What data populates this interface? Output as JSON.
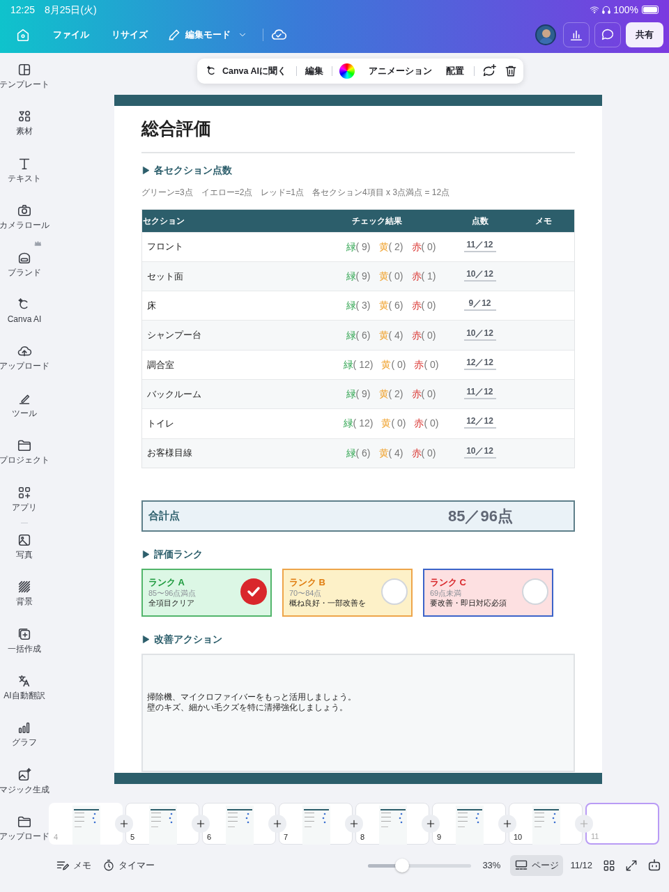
{
  "status_bar": {
    "time": "12:25",
    "date": "8月25日(火)",
    "battery": "100%"
  },
  "header": {
    "menu": [
      {
        "label": "ファイル",
        "kind": "plain"
      },
      {
        "label": "リサイズ",
        "kind": "plain"
      },
      {
        "label": "編集モード",
        "kind": "mode"
      }
    ],
    "share": "共有"
  },
  "toolbar": {
    "items": [
      "Canva AIに聞く",
      "編集",
      "アニメーション",
      "配置"
    ]
  },
  "sidebar": {
    "items": [
      {
        "label": "テンプレート"
      },
      {
        "label": "素材"
      },
      {
        "label": "テキスト"
      },
      {
        "label": "カメラロール"
      },
      {
        "label": "ブランド"
      },
      {
        "label": "Canva AI"
      },
      {
        "label": "アップロード"
      },
      {
        "label": "ツール"
      },
      {
        "label": "プロジェクト"
      },
      {
        "label": "アプリ"
      },
      {
        "label": "写真"
      },
      {
        "label": "背景"
      },
      {
        "label": "一括作成"
      },
      {
        "label": "AI自動翻訳"
      },
      {
        "label": "グラフ"
      },
      {
        "label": "マジック生成"
      },
      {
        "label": "アップロード"
      }
    ]
  },
  "document": {
    "title": "総合評価",
    "scores": {
      "heading": "各セクション点数",
      "legend": "グリーン=3点　イエロー=2点　レッド=1点　各セクション4項目 x 3点満点 = 12点",
      "columns": [
        "セクション",
        "チェック結果",
        "点数",
        "メモ"
      ],
      "rows": [
        {
          "section": "フロント",
          "checks": [
            {
              "kind": "green",
              "label": "緑",
              "count": "( 9)"
            },
            {
              "kind": "yellow",
              "label": "黄",
              "count": "( 2)"
            },
            {
              "kind": "red",
              "label": "赤",
              "count": "( 0)"
            }
          ],
          "score": "11／12"
        },
        {
          "section": "セット面",
          "checks": [
            {
              "kind": "green",
              "label": "緑",
              "count": "( 9)"
            },
            {
              "kind": "yellow",
              "label": "黄",
              "count": "( 0)"
            },
            {
              "kind": "red",
              "label": "赤",
              "count": "( 1)"
            }
          ],
          "score": "10／12"
        },
        {
          "section": "床",
          "checks": [
            {
              "kind": "green",
              "label": "緑",
              "count": "( 3)"
            },
            {
              "kind": "yellow",
              "label": "黄",
              "count": "( 6)"
            },
            {
              "kind": "red",
              "label": "赤",
              "count": "( 0)"
            }
          ],
          "score": "9／12"
        },
        {
          "section": "シャンプー台",
          "checks": [
            {
              "kind": "green",
              "label": "緑",
              "count": "( 6)"
            },
            {
              "kind": "yellow",
              "label": "黄",
              "count": "( 4)"
            },
            {
              "kind": "red",
              "label": "赤",
              "count": "( 0)"
            }
          ],
          "score": "10／12"
        },
        {
          "section": "調合室",
          "checks": [
            {
              "kind": "green",
              "label": "緑",
              "count": "( 12)"
            },
            {
              "kind": "yellow",
              "label": "黄",
              "count": "( 0)"
            },
            {
              "kind": "red",
              "label": "赤",
              "count": "( 0)"
            }
          ],
          "score": "12／12"
        },
        {
          "section": "バックルーム",
          "checks": [
            {
              "kind": "green",
              "label": "緑",
              "count": "( 9)"
            },
            {
              "kind": "yellow",
              "label": "黄",
              "count": "( 2)"
            },
            {
              "kind": "red",
              "label": "赤",
              "count": "( 0)"
            }
          ],
          "score": "11／12"
        },
        {
          "section": "トイレ",
          "checks": [
            {
              "kind": "green",
              "label": "緑",
              "count": "( 12)"
            },
            {
              "kind": "yellow",
              "label": "黄",
              "count": "( 0)"
            },
            {
              "kind": "red",
              "label": "赤",
              "count": "( 0)"
            }
          ],
          "score": "12／12"
        },
        {
          "section": "お客様目線",
          "checks": [
            {
              "kind": "green",
              "label": "緑",
              "count": "( 6)"
            },
            {
              "kind": "yellow",
              "label": "黄",
              "count": "( 4)"
            },
            {
              "kind": "red",
              "label": "赤",
              "count": "( 0)"
            }
          ],
          "score": "10／12"
        }
      ]
    },
    "total": {
      "label": "合計点",
      "value": "85／96点"
    },
    "ranks": {
      "heading": "評価ランク",
      "items": [
        {
          "kind": "a",
          "title": "ランク A",
          "range": "85〜96点満点",
          "note": "全項目クリア",
          "selected": true
        },
        {
          "kind": "b",
          "title": "ランク B",
          "range": "70〜84点",
          "note": "概ね良好・一部改善を",
          "selected": false
        },
        {
          "kind": "c",
          "title": "ランク C",
          "range": "69点未満",
          "note": "要改善・即日対応必須",
          "selected": false
        }
      ]
    },
    "actions": {
      "heading": "改善アクション",
      "lines": [
        "掃除機、マイクロファイバーをもっと活用しましょう。",
        "壁のキズ、細かい毛クズを特に清掃強化しましょう。"
      ]
    }
  },
  "pages": [
    {
      "number": "4",
      "selected": false
    },
    {
      "number": "5",
      "selected": false
    },
    {
      "number": "6",
      "selected": false
    },
    {
      "number": "7",
      "selected": false
    },
    {
      "number": "8",
      "selected": false
    },
    {
      "number": "9",
      "selected": false
    },
    {
      "number": "10",
      "selected": false
    },
    {
      "number": "11",
      "selected": true
    }
  ],
  "footer": {
    "memo": "メモ",
    "timer": "タイマー",
    "zoom": {
      "level": 0.33,
      "reading": "33%"
    },
    "page_view": "ページ",
    "page_count": "11/12"
  }
}
